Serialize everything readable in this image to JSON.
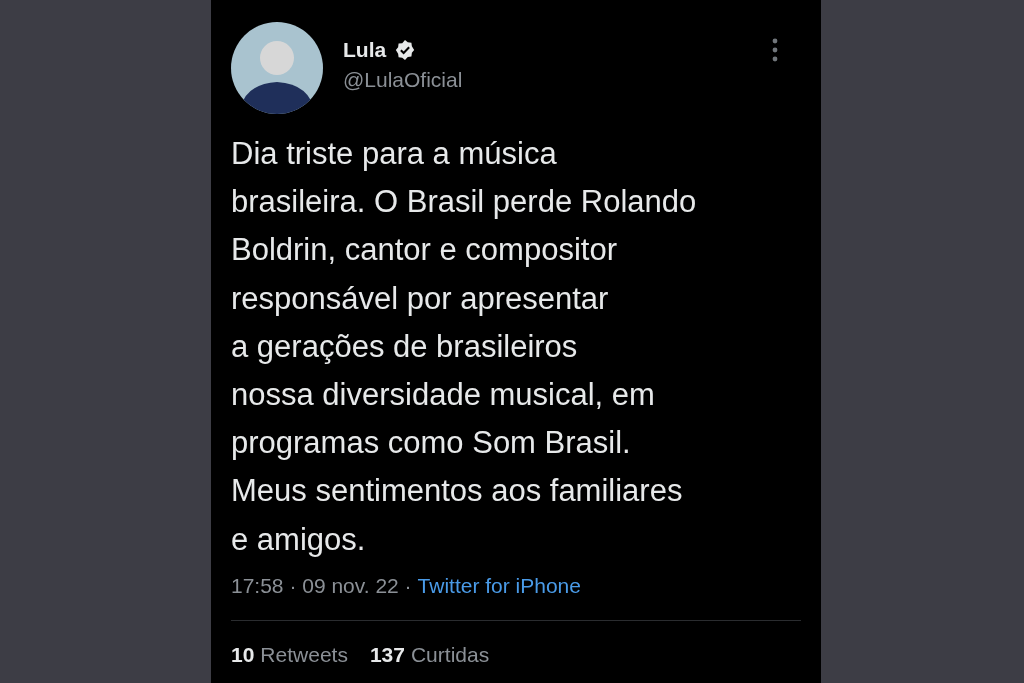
{
  "tweet": {
    "author": {
      "name": "Lula",
      "verified": true,
      "handle": "@LulaOficial"
    },
    "text_lines": [
      "Dia triste para a música",
      "brasileira. O Brasil perde Rolando",
      "Boldrin, cantor e compositor",
      "responsável por apresentar",
      "a gerações de brasileiros",
      "nossa diversidade musical, em",
      "programas como Som Brasil.",
      "Meus sentimentos aos familiares",
      "e amigos."
    ],
    "timestamp": "17:58 · 09 nov. 22 ·",
    "source": "Twitter for iPhone",
    "stats": [
      {
        "count": "10",
        "label": "Retweets"
      },
      {
        "count": "137",
        "label": "Curtidas"
      }
    ]
  }
}
